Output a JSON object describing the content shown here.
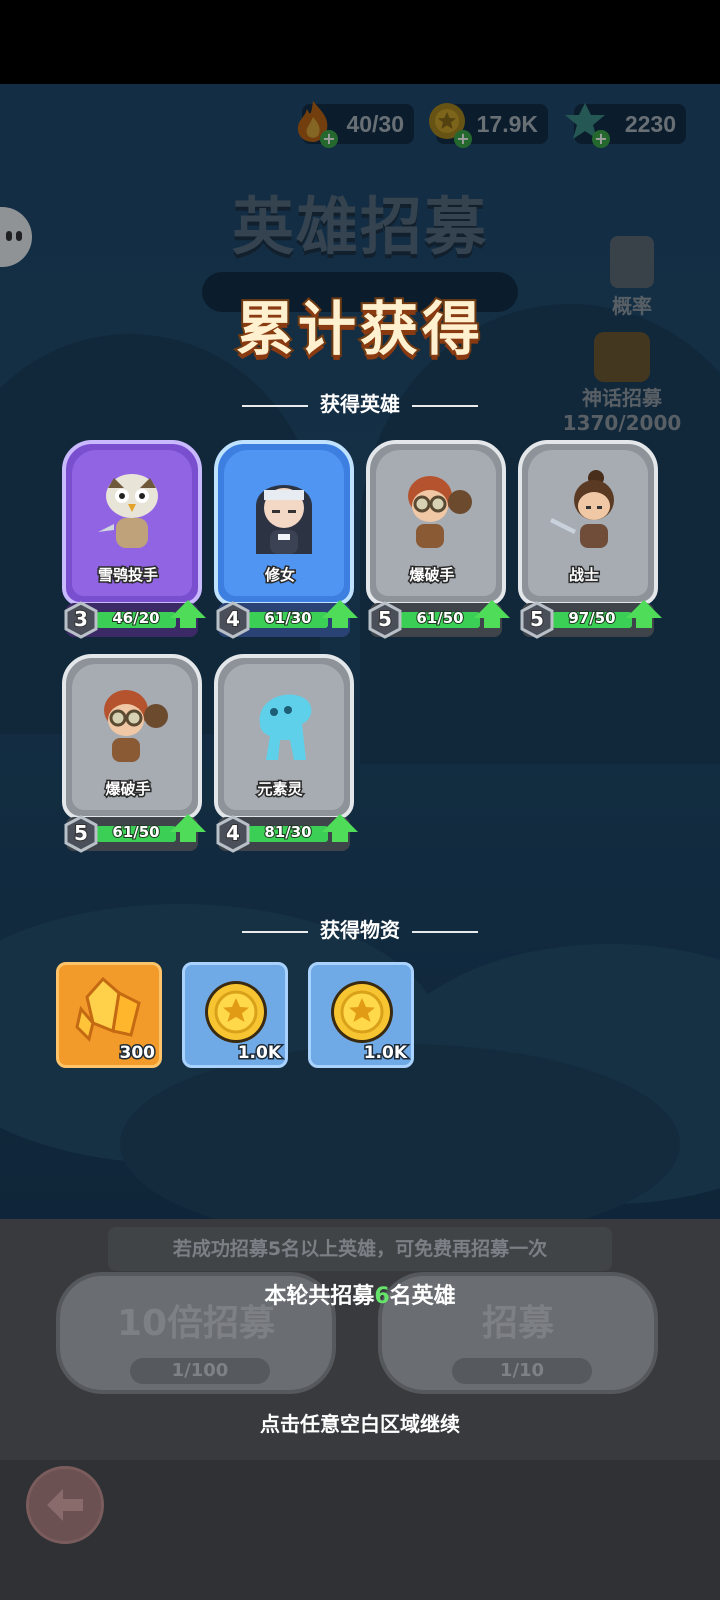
{
  "resources": [
    {
      "name": "stamina",
      "value": "40/30",
      "icon": "flame-icon",
      "color": "#f08a1e"
    },
    {
      "name": "gold",
      "value": "17.9K",
      "icon": "coin-icon",
      "color": "#e8b520"
    },
    {
      "name": "gems",
      "value": "2230",
      "icon": "crystal-icon",
      "color": "#57c9c0"
    }
  ],
  "background": {
    "title": "英雄招募",
    "probability_label": "概率",
    "mythic_label": "神话招募",
    "mythic_progress": "1370/2000"
  },
  "result": {
    "title": "累计获得",
    "heroes_header": "获得英雄",
    "items_header": "获得物资",
    "heroes": [
      {
        "name": "雪鸮投手",
        "level": "3",
        "progress": "46/20",
        "fill": 1.0,
        "rarity": "purple",
        "icon": "owl-thrower-portrait"
      },
      {
        "name": "修女",
        "level": "4",
        "progress": "61/30",
        "fill": 1.0,
        "rarity": "blue",
        "icon": "nun-portrait"
      },
      {
        "name": "爆破手",
        "level": "5",
        "progress": "61/50",
        "fill": 1.0,
        "rarity": "gray",
        "icon": "bomber-portrait"
      },
      {
        "name": "战士",
        "level": "5",
        "progress": "97/50",
        "fill": 1.0,
        "rarity": "gray",
        "icon": "warrior-portrait"
      },
      {
        "name": "爆破手",
        "level": "5",
        "progress": "61/50",
        "fill": 1.0,
        "rarity": "gray",
        "icon": "bomber-portrait"
      },
      {
        "name": "元素灵",
        "level": "4",
        "progress": "81/30",
        "fill": 1.0,
        "rarity": "gray",
        "icon": "elemental-portrait"
      }
    ],
    "items": [
      {
        "qty": "300",
        "icon": "crystal-shard-icon",
        "style": "orange"
      },
      {
        "qty": "1.0K",
        "icon": "coin-icon",
        "style": "blue"
      },
      {
        "qty": "1.0K",
        "icon": "coin-icon",
        "style": "blue"
      }
    ]
  },
  "bottom": {
    "free_note": "若成功招募5名以上英雄，可免费再招募一次",
    "round_prefix": "本轮共招募",
    "round_count": "6",
    "round_suffix": "名英雄",
    "ten_recruit_label": "10倍招募",
    "ten_recruit_key": "1/100",
    "recruit_label": "招募",
    "recruit_key": "1/10",
    "tap_continue": "点击任意空白区域继续"
  }
}
